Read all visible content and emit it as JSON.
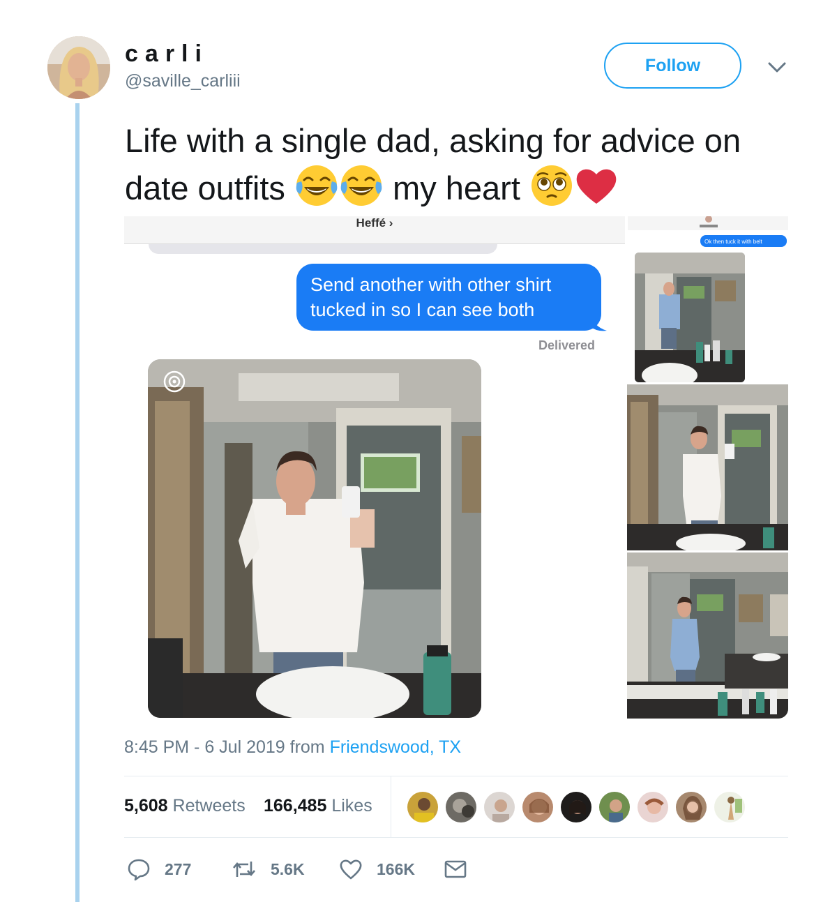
{
  "author": {
    "display_name": "carli",
    "handle": "@saville_carliii"
  },
  "follow_label": "Follow",
  "tweet": {
    "text_part1": "Life with a single dad, asking for advice on date outfits ",
    "text_part2": " my heart ",
    "emojis": [
      "face-with-tears-of-joy",
      "face-with-tears-of-joy",
      "pleading-face",
      "red-heart"
    ]
  },
  "media": {
    "contact_name": "Heffé ›",
    "sent_message": "Send another with other shirt tucked in so I can see both",
    "status": "Delivered",
    "thumb_mini_message": "Ok then tuck it with belt"
  },
  "timestamp": {
    "time_date": "8:45 PM - 6 Jul 2019 from ",
    "location": "Friendswood, TX"
  },
  "stats": {
    "retweets_count": "5,608",
    "retweets_label": "Retweets",
    "likes_count": "166,485",
    "likes_label": "Likes"
  },
  "actions": {
    "reply_count": "277",
    "retweet_count": "5.6K",
    "like_count": "166K"
  },
  "colors": {
    "accent": "#1da1f2",
    "imessage_blue": "#1a7cf5",
    "muted": "#657786",
    "thread_line": "#a9d2ee"
  }
}
